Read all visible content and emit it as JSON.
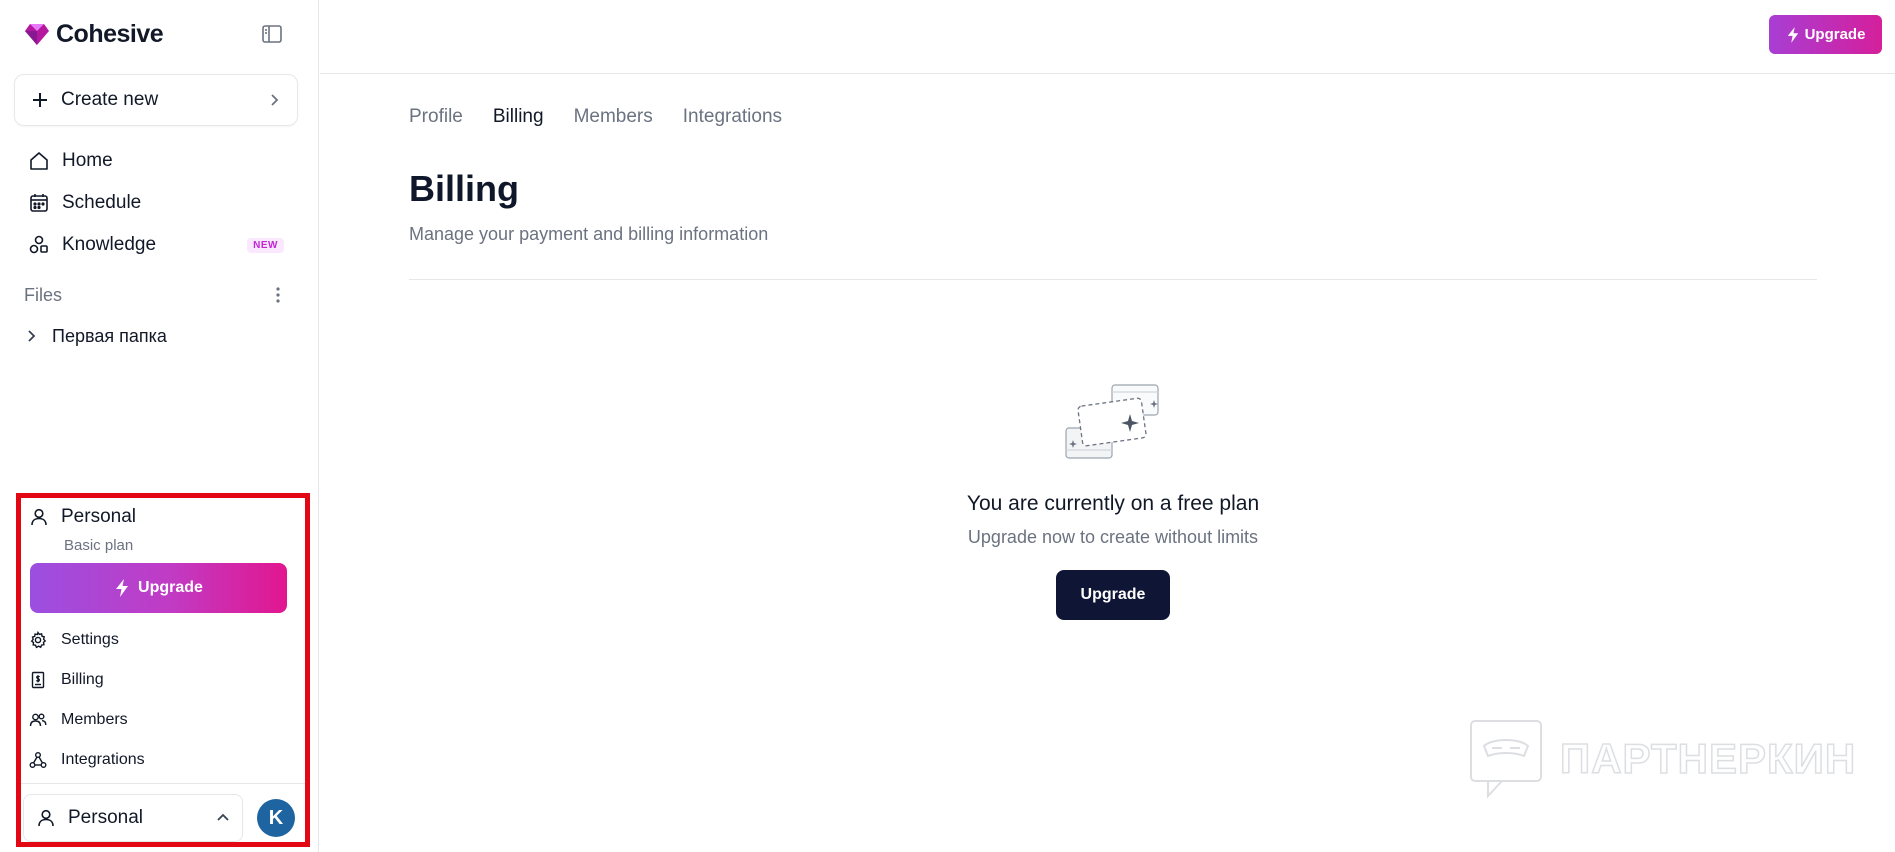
{
  "brand": {
    "name": "Cohesive",
    "accent": "#c026d3"
  },
  "sidebar": {
    "create_label": "Create new",
    "nav": [
      {
        "label": "Home",
        "icon": "home-icon"
      },
      {
        "label": "Schedule",
        "icon": "calendar-icon"
      },
      {
        "label": "Knowledge",
        "icon": "knowledge-icon",
        "badge": "NEW"
      }
    ],
    "files_label": "Files",
    "folders": [
      {
        "label": "Первая папка"
      }
    ]
  },
  "menu": {
    "workspace_name": "Personal",
    "plan": "Basic plan",
    "upgrade_label": "Upgrade",
    "items": [
      {
        "label": "Settings",
        "icon": "gear-icon"
      },
      {
        "label": "Billing",
        "icon": "receipt-icon"
      },
      {
        "label": "Members",
        "icon": "users-icon"
      },
      {
        "label": "Integrations",
        "icon": "integrations-icon"
      }
    ],
    "switcher_label": "Personal",
    "avatar_initial": "K"
  },
  "topbar": {
    "upgrade_label": "Upgrade"
  },
  "main": {
    "tabs": [
      {
        "label": "Profile",
        "active": false
      },
      {
        "label": "Billing",
        "active": true
      },
      {
        "label": "Members",
        "active": false
      },
      {
        "label": "Integrations",
        "active": false
      }
    ],
    "title": "Billing",
    "subtitle": "Manage your payment and billing information",
    "empty_title": "You are currently on a free plan",
    "empty_subtitle": "Upgrade now to create without limits",
    "empty_button": "Upgrade"
  },
  "watermark": "ПАРТНЕРКИН"
}
